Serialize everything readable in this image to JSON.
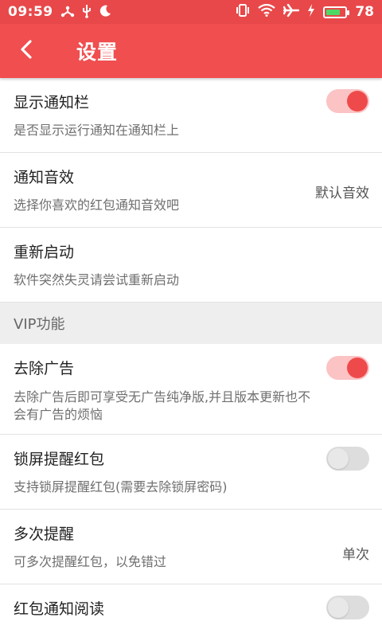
{
  "status_bar": {
    "time": "09:59",
    "battery": "78",
    "battery_level": 0.78
  },
  "header": {
    "title": "设置"
  },
  "settings": [
    {
      "title": "显示通知栏",
      "subtitle": "是否显示运行通知在通知栏上",
      "toggle": true
    },
    {
      "title": "通知音效",
      "subtitle": "选择你喜欢的红包通知音效吧",
      "value": "默认音效"
    },
    {
      "title": "重新启动",
      "subtitle": "软件突然失灵请尝试重新启动"
    }
  ],
  "vip_section": {
    "label": "VIP功能"
  },
  "vip_settings": [
    {
      "title": "去除广告",
      "subtitle_line1": "去除广告后即可享受无广告纯净版,并且版本更新也不",
      "subtitle_line2": "会有广告的烦恼",
      "toggle": true
    },
    {
      "title": "锁屏提醒红包",
      "subtitle": "支持锁屏提醒红包(需要去除锁屏密码)",
      "toggle": false
    },
    {
      "title": "多次提醒",
      "subtitle": "可多次提醒红包，以免错过",
      "value": "单次"
    },
    {
      "title": "红包通知阅读",
      "toggle": false
    }
  ],
  "colors": {
    "status_bar": "#e8484a",
    "app_bar": "#f04e4f",
    "accent": "#ef4a4b"
  }
}
